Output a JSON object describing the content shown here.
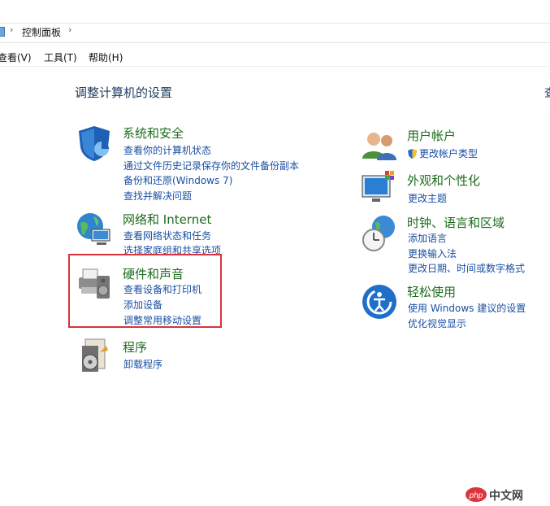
{
  "breadcrumb": {
    "current": "控制面板"
  },
  "menu": [
    "查看(V)",
    "工具(T)",
    "帮助(H)"
  ],
  "heading": "调整计算机的设置",
  "right_cut_text": "查",
  "left_column": [
    {
      "title": "系统和安全",
      "icon": "shield-icon",
      "links": [
        "查看你的计算机状态",
        "通过文件历史记录保存你的文件备份副本",
        "备份和还原(Windows 7)",
        "查找并解决问题"
      ]
    },
    {
      "title": "网络和 Internet",
      "icon": "network-globe-icon",
      "links": [
        "查看网络状态和任务",
        "选择家庭组和共享选项"
      ]
    },
    {
      "title": "硬件和声音",
      "icon": "printer-speaker-icon",
      "links": [
        "查看设备和打印机",
        "添加设备",
        "调整常用移动设置"
      ]
    },
    {
      "title": "程序",
      "icon": "programs-disc-icon",
      "links": [
        "卸载程序"
      ]
    }
  ],
  "right_column": [
    {
      "title": "用户帐户",
      "icon": "users-icon",
      "links": [
        "更改帐户类型"
      ]
    },
    {
      "title": "外观和个性化",
      "icon": "display-palette-icon",
      "links": [
        "更改主题"
      ]
    },
    {
      "title": "时钟、语言和区域",
      "icon": "clock-globe-icon",
      "links": [
        "添加语言",
        "更换输入法",
        "更改日期、时间或数字格式"
      ]
    },
    {
      "title": "轻松使用",
      "icon": "ease-of-access-icon",
      "links": [
        "使用 Windows 建议的设置",
        "优化视觉显示"
      ]
    }
  ],
  "watermark": {
    "text": "中文网",
    "logo": "php"
  }
}
